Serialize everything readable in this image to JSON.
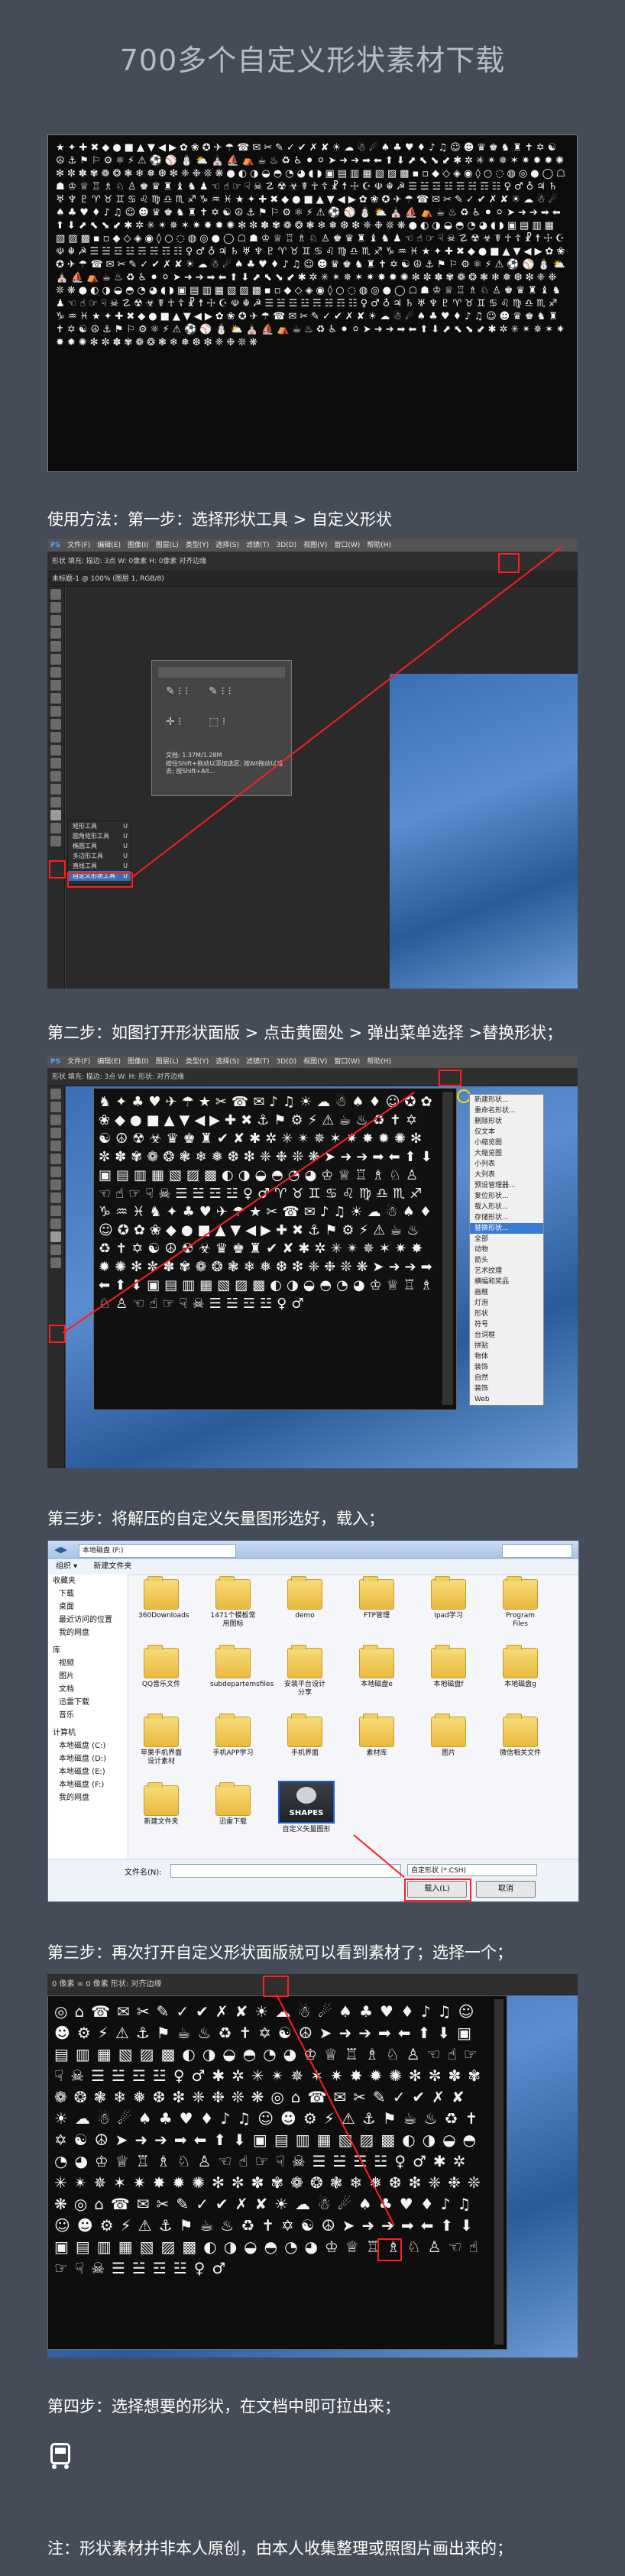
{
  "title": "700多个自定义形状素材下载",
  "steps": {
    "s1": "使用方法：第一步：选择形状工具 > 自定义形状",
    "s2": "第二步：如图打开形状面版 > 点击黄圈处 > 弹出菜单选择 >替换形状；",
    "s3": "第三步：将解压的自定义矢量图形选好，载入；",
    "s4": "第三步：再次打开自定义形状面版就可以看到素材了；选择一个；",
    "s5": "第四步：选择想要的形状，在文档中即可拉出来；",
    "note": "注：形状素材并非本人原创，由本人收集整理或照图片画出来的；"
  },
  "shot1": {
    "menu": [
      "PS",
      "文件(F)",
      "编辑(E)",
      "图像(I)",
      "图层(L)",
      "类型(Y)",
      "选择(S)",
      "滤镜(T)",
      "3D(D)",
      "视图(V)",
      "窗口(W)",
      "帮助(H)"
    ],
    "options": "形状   填充:   描边:   3点   W: 0像素   H: 0像素   对齐边缘",
    "doc_tab": "未标题-1 @ 100% (图层 1, RGB/8)",
    "flyout": [
      "矩形工具",
      "圆角矩形工具",
      "椭圆工具",
      "多边形工具",
      "直线工具",
      "自定义形状工具"
    ],
    "flyout_keys": [
      "U",
      "U",
      "U",
      "U",
      "U",
      "U"
    ],
    "dialog_text": "文档: 1.37M/1.28M",
    "dialog_text2": "按住Shift+拖动以添加选区; 按Alt拖动以减去; 按Shift+Alt..."
  },
  "shot2": {
    "menu": [
      "PS",
      "文件(F)",
      "编辑(E)",
      "图像(I)",
      "图层(L)",
      "类型(Y)",
      "选择(S)",
      "滤镜(T)",
      "3D(D)",
      "视图(V)",
      "窗口(W)",
      "帮助(H)"
    ],
    "options": "形状   填充:   描边:   3点   W:   H:   形状:   对齐边缘",
    "popup_menu": [
      "新建形状...",
      "重命名形状...",
      "删除形状",
      "仅文本",
      "小缩览图",
      "大缩览图",
      "小列表",
      "大列表",
      "预设管理器...",
      "复位形状...",
      "载入形状...",
      "存储形状...",
      "替换形状...",
      "全部",
      "动物",
      "箭头",
      "艺术纹理",
      "横幅和奖品",
      "画框",
      "灯泡",
      "形状",
      "符号",
      "台词框",
      "拼贴",
      "物体",
      "装饰",
      "自然",
      "装饰",
      "Web"
    ],
    "selected_index": 12
  },
  "shot3": {
    "window_title": "本地磁盘 (F:)",
    "toolbar": [
      "组织 ▾",
      "新建文件夹"
    ],
    "nav": [
      "收藏夹",
      "下载",
      "桌面",
      "最近访问的位置",
      "我的网盘",
      "库",
      "视频",
      "图片",
      "文档",
      "迅雷下载",
      "音乐",
      "计算机",
      "本地磁盘 (C:)",
      "本地磁盘 (D:)",
      "本地磁盘 (E:)",
      "本地磁盘 (F:)",
      "我的网盘"
    ],
    "files": [
      "360Downloads",
      "1471个模板常用图标",
      "demo",
      "FTP管理",
      "Ipad学习",
      "Program Files",
      "QQ音乐文件",
      "subdepartemsfiles",
      "安装平台设计分享",
      "本地磁盘e",
      "本地磁盘f",
      "本地磁盘g",
      "苹果手机界面设计素材",
      "手机APP学习",
      "手机界面",
      "素材库",
      "图片",
      "微信相关文件",
      "新建文件夹",
      "迅雷下载",
      "自定义矢量图形"
    ],
    "shapes_label": "SHAPES",
    "filename_label": "文件名(N):",
    "filetype": "自定形状 (*.CSH)",
    "load_button": "载入(L)",
    "cancel_button": "取消"
  },
  "shot4": {
    "options": "0 像素   ∞   0 像素   形状:   对齐边缘"
  },
  "colors": {
    "bg": "#454c57",
    "red": "#ff1d1d",
    "blue": "#3b6fb3"
  },
  "icons": [
    "shapes-grid",
    "folder-icon",
    "shapes-file-icon",
    "bus-icon"
  ]
}
